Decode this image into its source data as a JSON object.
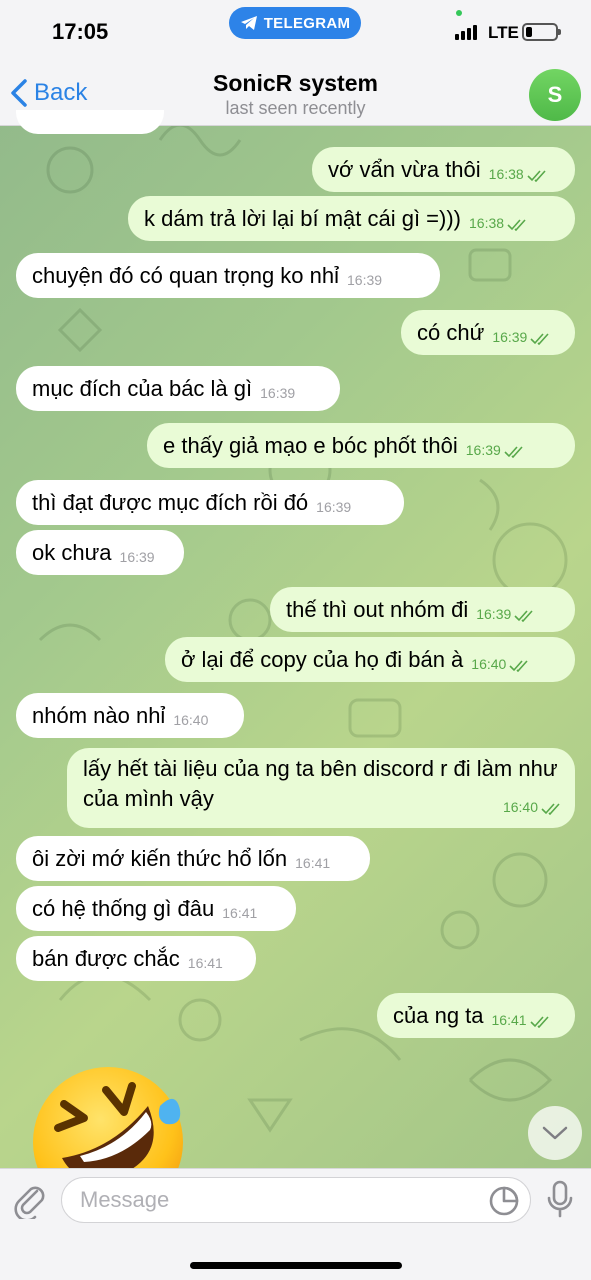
{
  "status_bar": {
    "time": "17:05",
    "pill_label": "TELEGRAM",
    "network": "LTE"
  },
  "header": {
    "back_label": "Back",
    "title": "SonicR system",
    "subtitle": "last seen recently",
    "avatar_letter": "S"
  },
  "messages": [
    {
      "dir": "out",
      "text": "vớ vẩn vừa thôi",
      "time": "16:38"
    },
    {
      "dir": "out",
      "text": "k dám trả lời lại bí mật cái gì =)))",
      "time": "16:38"
    },
    {
      "dir": "in",
      "text": "chuyện đó có quan trọng ko nhỉ",
      "time": "16:39"
    },
    {
      "dir": "out",
      "text": "có chứ",
      "time": "16:39"
    },
    {
      "dir": "in",
      "text": "mục đích của bác là gì",
      "time": "16:39"
    },
    {
      "dir": "out",
      "text": "e thấy giả mạo e bóc phốt thôi",
      "time": "16:39"
    },
    {
      "dir": "in",
      "text": "thì đạt được mục đích rồi đó",
      "time": "16:39"
    },
    {
      "dir": "in",
      "text": "ok chưa",
      "time": "16:39"
    },
    {
      "dir": "out",
      "text": "thế thì out nhóm đi",
      "time": "16:39"
    },
    {
      "dir": "out",
      "text": "ở lại để copy của họ đi bán à",
      "time": "16:40"
    },
    {
      "dir": "in",
      "text": "nhóm nào nhỉ",
      "time": "16:40"
    },
    {
      "dir": "out",
      "text": "lấy hết tài liệu của ng ta bên discord r đi làm như của mình vậy",
      "time": "16:40"
    },
    {
      "dir": "in",
      "text": "ôi zời mớ kiến thức hổ lốn",
      "time": "16:41"
    },
    {
      "dir": "in",
      "text": "có hệ thống gì đâu",
      "time": "16:41"
    },
    {
      "dir": "in",
      "text": "bán được chắc",
      "time": "16:41"
    },
    {
      "dir": "out",
      "text": "của ng ta",
      "time": "16:41"
    }
  ],
  "sticker": {
    "icon": "rofl-emoji-icon"
  },
  "input": {
    "placeholder": "Message"
  },
  "colors": {
    "accent": "#2b83e5",
    "outgoing_bubble": "#e9fbd6",
    "incoming_bubble": "#ffffff",
    "read_check": "#58a84a"
  }
}
